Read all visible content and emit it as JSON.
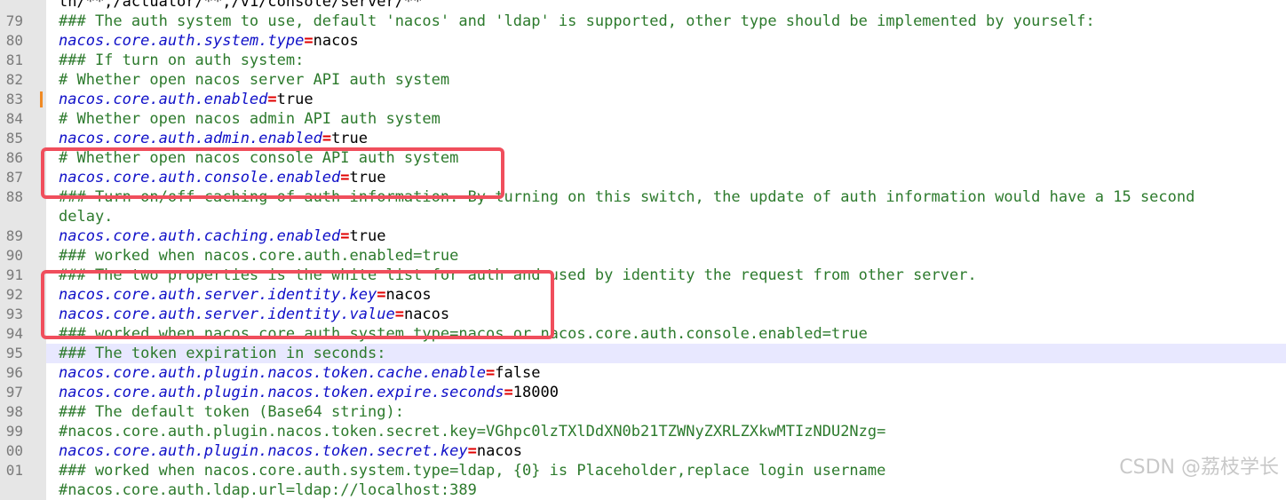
{
  "editor": {
    "lines": [
      {
        "num": "",
        "parts": [
          {
            "t": "th/**,/actuator/**,/v1/console/server/**",
            "c": "val"
          }
        ]
      },
      {
        "num": "79",
        "parts": [
          {
            "t": "### The auth system to use, default 'nacos' and 'ldap' is supported, other type should be implemented by yourself:",
            "c": "comment"
          }
        ]
      },
      {
        "num": "80",
        "parts": [
          {
            "t": "nacos.core.auth.system.type",
            "c": "key"
          },
          {
            "t": "=",
            "c": "eq"
          },
          {
            "t": "nacos",
            "c": "val"
          }
        ]
      },
      {
        "num": "81",
        "parts": [
          {
            "t": "### If turn on auth system:",
            "c": "comment"
          }
        ]
      },
      {
        "num": "82",
        "parts": [
          {
            "t": "# Whether open nacos server API auth system",
            "c": "comment"
          }
        ]
      },
      {
        "num": "83",
        "marker": true,
        "parts": [
          {
            "t": "nacos.core.auth.enabled",
            "c": "key"
          },
          {
            "t": "=",
            "c": "eq"
          },
          {
            "t": "true",
            "c": "val"
          }
        ]
      },
      {
        "num": "84",
        "parts": [
          {
            "t": "# Whether open nacos admin API auth system",
            "c": "comment"
          }
        ]
      },
      {
        "num": "85",
        "parts": [
          {
            "t": "nacos.core.auth.admin.enabled",
            "c": "key"
          },
          {
            "t": "=",
            "c": "eq"
          },
          {
            "t": "true",
            "c": "val"
          }
        ]
      },
      {
        "num": "86",
        "parts": [
          {
            "t": "# Whether open nacos console API auth system",
            "c": "comment"
          }
        ]
      },
      {
        "num": "87",
        "parts": [
          {
            "t": "nacos.core.auth.console.enabled",
            "c": "key"
          },
          {
            "t": "=",
            "c": "eq"
          },
          {
            "t": "true",
            "c": "val"
          }
        ]
      },
      {
        "num": "88",
        "parts": [
          {
            "t": "### Turn on/off caching of auth information. By turning on this switch, the update of auth information would have a 15 second",
            "c": "comment"
          }
        ]
      },
      {
        "num": "",
        "parts": [
          {
            "t": "delay.",
            "c": "comment"
          }
        ]
      },
      {
        "num": "89",
        "parts": [
          {
            "t": "nacos.core.auth.caching.enabled",
            "c": "key"
          },
          {
            "t": "=",
            "c": "eq"
          },
          {
            "t": "true",
            "c": "val"
          }
        ]
      },
      {
        "num": "90",
        "parts": [
          {
            "t": "### worked when nacos.core.auth.enabled=true",
            "c": "comment"
          }
        ]
      },
      {
        "num": "91",
        "parts": [
          {
            "t": "### The two properties is the white list for auth and used by identity the request from other server.",
            "c": "comment"
          }
        ]
      },
      {
        "num": "92",
        "parts": [
          {
            "t": "nacos.core.auth.server.identity.key",
            "c": "key"
          },
          {
            "t": "=",
            "c": "eq"
          },
          {
            "t": "nacos",
            "c": "val"
          }
        ]
      },
      {
        "num": "93",
        "parts": [
          {
            "t": "nacos.core.auth.server.identity.value",
            "c": "key"
          },
          {
            "t": "=",
            "c": "eq"
          },
          {
            "t": "nacos",
            "c": "val"
          }
        ]
      },
      {
        "num": "94",
        "parts": [
          {
            "t": "### worked when nacos.core.auth.system.type=nacos or nacos.core.auth.console.enabled=true",
            "c": "comment"
          }
        ]
      },
      {
        "num": "95",
        "hl": true,
        "parts": [
          {
            "t": "### The token expiration in seconds:",
            "c": "comment"
          }
        ]
      },
      {
        "num": "96",
        "parts": [
          {
            "t": "nacos.core.auth.plugin.nacos.token.cache.enable",
            "c": "key"
          },
          {
            "t": "=",
            "c": "eq"
          },
          {
            "t": "false",
            "c": "val"
          }
        ]
      },
      {
        "num": "97",
        "parts": [
          {
            "t": "nacos.core.auth.plugin.nacos.token.expire.seconds",
            "c": "key"
          },
          {
            "t": "=",
            "c": "eq"
          },
          {
            "t": "18000",
            "c": "val"
          }
        ]
      },
      {
        "num": "98",
        "parts": [
          {
            "t": "### The default token (Base64 string):",
            "c": "comment"
          }
        ]
      },
      {
        "num": "99",
        "parts": [
          {
            "t": "#nacos.core.auth.plugin.nacos.token.secret.key=VGhpc0lzTXlDdXN0b21TZWNyZXRLZXkwMTIzNDU2Nzg=",
            "c": "comment"
          }
        ]
      },
      {
        "num": "00",
        "parts": [
          {
            "t": "nacos.core.auth.plugin.nacos.token.secret.key",
            "c": "key"
          },
          {
            "t": "=",
            "c": "eq"
          },
          {
            "t": "nacos",
            "c": "val"
          }
        ]
      },
      {
        "num": "01",
        "parts": [
          {
            "t": "### worked when nacos.core.auth.system.type=ldap, {0} is Placeholder,replace login username",
            "c": "comment"
          }
        ]
      },
      {
        "num": "",
        "parts": [
          {
            "t": "#nacos.core.auth.ldap.url=ldap://localhost:389",
            "c": "comment"
          }
        ]
      }
    ]
  },
  "watermark": "CSDN @荔枝学长"
}
